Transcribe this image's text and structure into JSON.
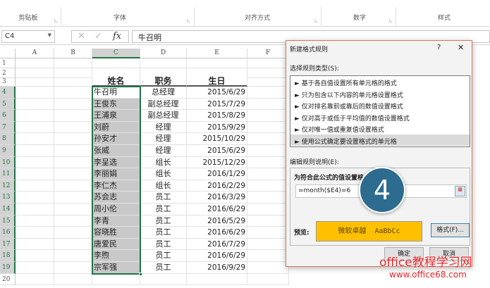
{
  "ribbon": {
    "groups": [
      "剪贴板",
      "字体",
      "对齐方式",
      "数字",
      "样式"
    ]
  },
  "formula_bar": {
    "name_box": "C4",
    "fx": "fx",
    "value": "牛召明"
  },
  "columns": [
    "A",
    "B",
    "C",
    "D",
    "E",
    "F"
  ],
  "rows": [
    "1",
    "2",
    "3",
    "4",
    "5",
    "6",
    "7",
    "8",
    "9",
    "10",
    "11",
    "12",
    "13",
    "14",
    "15",
    "16",
    "17",
    "18",
    "19",
    "20"
  ],
  "table": {
    "headers": [
      "姓名",
      "职务",
      "生日"
    ],
    "rows": [
      [
        "牛召明",
        "总经理",
        "2015/6/29"
      ],
      [
        "王俊东",
        "副总经理",
        "2015/7/29"
      ],
      [
        "王浦泉",
        "副总经理",
        "2015/8/29"
      ],
      [
        "刘蔚",
        "经理",
        "2015/9/29"
      ],
      [
        "孙安才",
        "经理",
        "2015/10/29"
      ],
      [
        "张威",
        "经理",
        "2015/6/29"
      ],
      [
        "李呈选",
        "组长",
        "2015/12/29"
      ],
      [
        "李丽娟",
        "组长",
        "2016/1/29"
      ],
      [
        "李仁杰",
        "组长",
        "2016/2/29"
      ],
      [
        "苏会志",
        "员工",
        "2016/3/29"
      ],
      [
        "周小伦",
        "员工",
        "2016/6/29"
      ],
      [
        "李青",
        "员工",
        "2016/5/29"
      ],
      [
        "容晓胜",
        "员工",
        "2016/6/29"
      ],
      [
        "唐爱民",
        "员工",
        "2016/7/29"
      ],
      [
        "李煦",
        "员工",
        "2016/6/29"
      ],
      [
        "宗军强",
        "员工",
        "2016/9/29"
      ]
    ]
  },
  "dialog": {
    "title": "新建格式规则",
    "help": "?",
    "close": "✕",
    "rule_type_label": "选择规则类型(S):",
    "rule_types": [
      "基于各自值设置所有单元格的格式",
      "只为包含以下内容的单元格设置格式",
      "仅对排名靠前或靠后的数值设置格式",
      "仅对高于或低于平均值的数值设置格式",
      "仅对唯一值或重复值设置格式",
      "使用公式确定要设置格式的单元格"
    ],
    "edit_label": "编辑规则说明(E):",
    "formula_label": "为符合此公式的值设置格式",
    "formula": "=month($E4)=6",
    "preview_label": "预览:",
    "preview_text": "微软卓越  AaBbCc",
    "format_button": "格式(F)...",
    "ok": "确定",
    "cancel": "取消"
  },
  "step_badge": "4",
  "watermark": {
    "title": "office教程学习网",
    "url": "www.office68.com"
  },
  "colors": {
    "accent": "#217346",
    "preview_fill": "#ffc000",
    "badge": "#2d6b8f",
    "watermark": "#e8262a"
  }
}
